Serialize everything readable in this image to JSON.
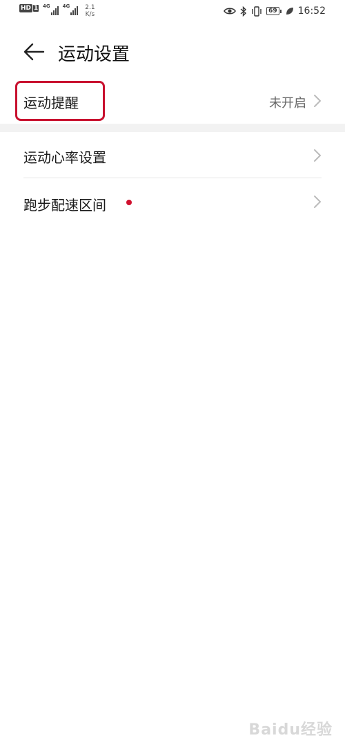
{
  "status_bar": {
    "hd_label": "HD",
    "sim_label": "1",
    "sim1_network": "4G",
    "sim2_network": "4G",
    "speed_value": "2.1",
    "speed_unit": "K/s",
    "battery_level": "69",
    "time": "16:52"
  },
  "header": {
    "title": "运动设置"
  },
  "rows": [
    {
      "label": "运动提醒",
      "value": "未开启",
      "highlighted": true
    },
    {
      "label": "运动心率设置",
      "value": ""
    },
    {
      "label": "跑步配速区间",
      "value": "",
      "has_dot": true
    }
  ],
  "colors": {
    "highlight": "#c8102e",
    "badge_dot": "#d0102e",
    "separator": "#f2f2f2"
  },
  "watermark": {
    "text": "Baidu经验"
  }
}
